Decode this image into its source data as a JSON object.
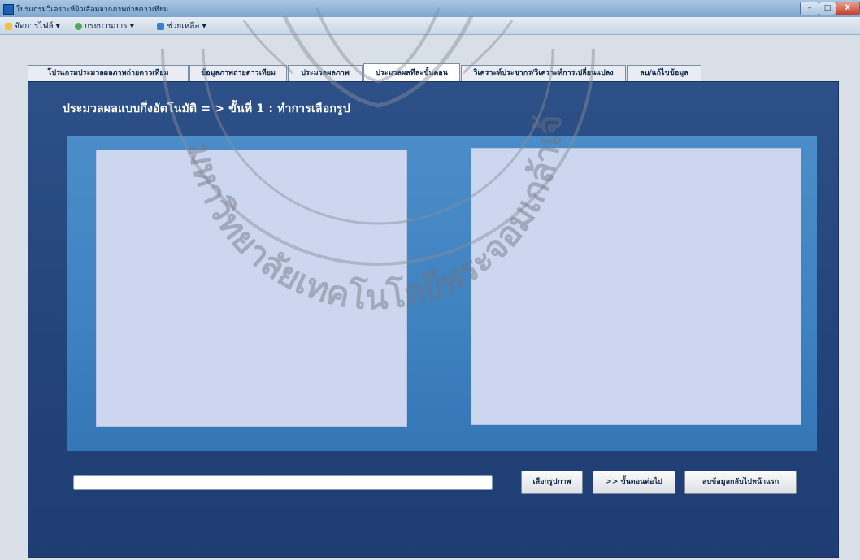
{
  "window": {
    "title": "โปรแกรมวิเคราะห์ผิวเสื่อมจากภาพถ่ายดาวเทียม",
    "controls": {
      "minimize": "–",
      "maximize": "□",
      "close": "X"
    }
  },
  "menu": {
    "items": [
      {
        "label": "จัดการไฟล์ ▾",
        "icon": "folder-icon"
      },
      {
        "label": "กระบวนการ ▾",
        "icon": "gear-icon"
      },
      {
        "label": "ช่วยเหลือ ▾",
        "icon": "help-icon"
      }
    ]
  },
  "tabs": [
    {
      "label": "โปรแกรมประมวลผลภาพถ่ายดาวเทียม",
      "active": false
    },
    {
      "label": "ข้อมูลภาพถ่ายดาวเทียม",
      "active": false
    },
    {
      "label": "ประมวลผลภาพ",
      "active": false
    },
    {
      "label": "ประมวลผลทีละขั้นตอน",
      "active": true
    },
    {
      "label": "วิเคราะห์ประชากร/วิเคราะห์การเปลี่ยนแปลง",
      "active": false
    },
    {
      "label": "ลบ/แก้ไขข้อมูล",
      "active": false
    }
  ],
  "panel": {
    "heading": "ประมวลผลแบบกึ่งอัตโนมัติ = > ขั้นที่ 1 : ทำการเลือกรูป",
    "path_value": "",
    "buttons": {
      "select_image": "เลือกรูปภาพ",
      "next_step": ">> ขั้นตอนต่อไป",
      "reset": "ลบข้อมูลกลับไปหน้าแรก"
    }
  },
  "colors": {
    "panel_bg": "#2d5088",
    "inner_bg": "#4a8dc8",
    "image_placeholder": "#ccd6ee",
    "heading_text": "#ffffff"
  },
  "watermark": {
    "text": "มหาวิทยาลัยเทคโนโลยีพระจอมเกล้าเจ้าคุณทหารลาดกระบัง"
  }
}
